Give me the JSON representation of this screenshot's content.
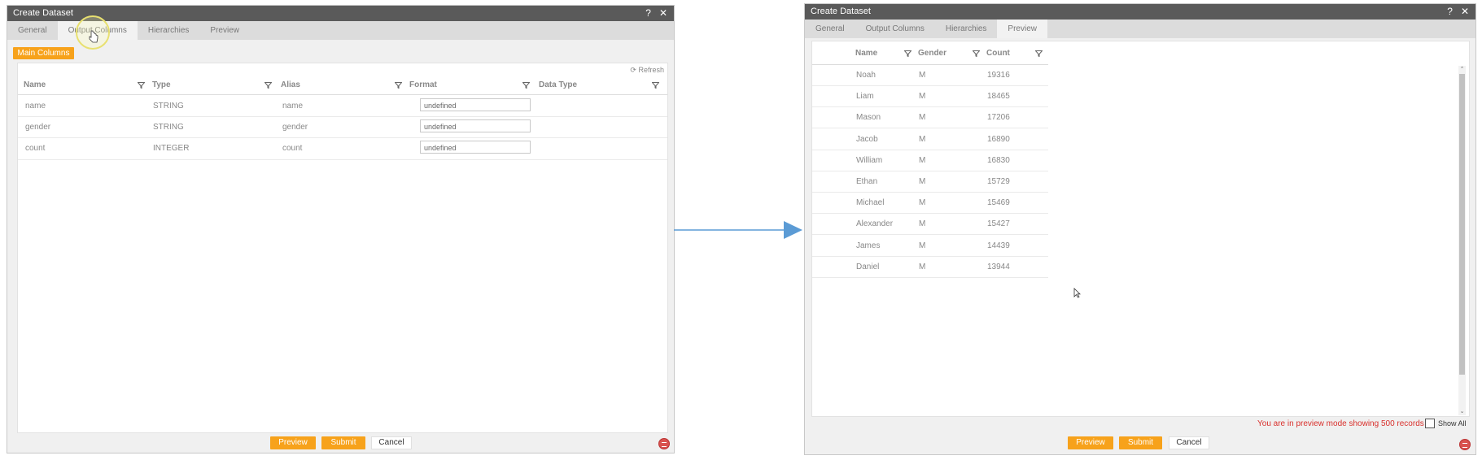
{
  "left_dialog": {
    "title": "Create Dataset",
    "help": "?",
    "close": "✕",
    "tabs": [
      "General",
      "Output Columns",
      "Hierarchies",
      "Preview"
    ],
    "main_columns_label": "Main Columns",
    "refresh_label": "Refresh",
    "headers": [
      "Name",
      "Type",
      "Alias",
      "Format",
      "Data Type"
    ],
    "rows": [
      {
        "name": "name",
        "type": "STRING",
        "alias": "name",
        "format": "undefined"
      },
      {
        "name": "gender",
        "type": "STRING",
        "alias": "gender",
        "format": "undefined"
      },
      {
        "name": "count",
        "type": "INTEGER",
        "alias": "count",
        "format": "undefined"
      }
    ],
    "buttons": {
      "preview": "Preview",
      "submit": "Submit",
      "cancel": "Cancel"
    }
  },
  "right_dialog": {
    "title": "Create Dataset",
    "help": "?",
    "close": "✕",
    "tabs": [
      "General",
      "Output Columns",
      "Hierarchies",
      "Preview"
    ],
    "headers": [
      "Name",
      "Gender",
      "Count"
    ],
    "rows": [
      {
        "name": "Noah",
        "gender": "M",
        "count": "19316"
      },
      {
        "name": "Liam",
        "gender": "M",
        "count": "18465"
      },
      {
        "name": "Mason",
        "gender": "M",
        "count": "17206"
      },
      {
        "name": "Jacob",
        "gender": "M",
        "count": "16890"
      },
      {
        "name": "William",
        "gender": "M",
        "count": "16830"
      },
      {
        "name": "Ethan",
        "gender": "M",
        "count": "15729"
      },
      {
        "name": "Michael",
        "gender": "M",
        "count": "15469"
      },
      {
        "name": "Alexander",
        "gender": "M",
        "count": "15427"
      },
      {
        "name": "James",
        "gender": "M",
        "count": "14439"
      },
      {
        "name": "Daniel",
        "gender": "M",
        "count": "13944"
      }
    ],
    "preview_notice": "You are in preview mode showing 500 records",
    "show_all_label": "Show All",
    "buttons": {
      "preview": "Preview",
      "submit": "Submit",
      "cancel": "Cancel"
    }
  },
  "colors": {
    "accent": "#f7a21b",
    "arrow": "#5b9bd5",
    "titlebar": "#5a5a5a",
    "notice": "#d9302c"
  }
}
